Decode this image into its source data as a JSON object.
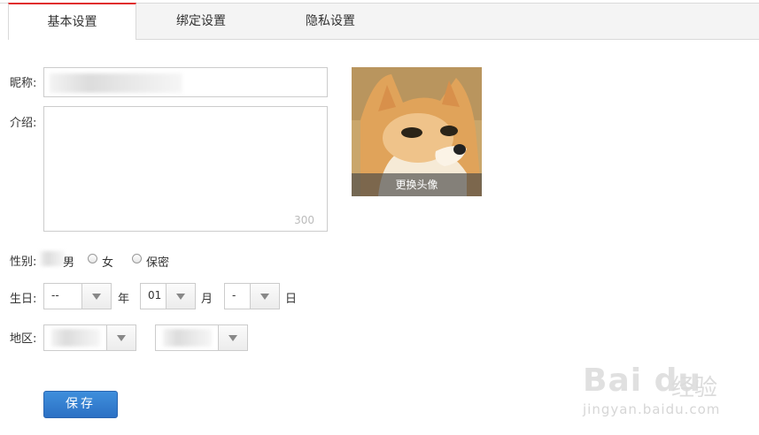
{
  "tabs": [
    {
      "label": "基本设置",
      "active": true
    },
    {
      "label": "绑定设置",
      "active": false
    },
    {
      "label": "隐私设置",
      "active": false
    }
  ],
  "form": {
    "nickname_label": "昵称:",
    "intro_label": "介绍:",
    "intro_counter": "300",
    "gender_label": "性别:",
    "gender_options": [
      "男",
      "女",
      "保密"
    ],
    "birthday_label": "生日:",
    "birthday": {
      "year": "--",
      "year_unit": "年",
      "month": "01",
      "month_unit": "月",
      "day": "-",
      "day_unit": "日"
    },
    "region_label": "地区:"
  },
  "avatar": {
    "change_label": "更换头像"
  },
  "save_label": "保存",
  "watermark": {
    "brand": "Bai du",
    "cn": "经验",
    "url": "jingyan.baidu.com"
  },
  "colors": {
    "accent_tab": "#e02d2d",
    "save_button": "#2f7bd0"
  }
}
